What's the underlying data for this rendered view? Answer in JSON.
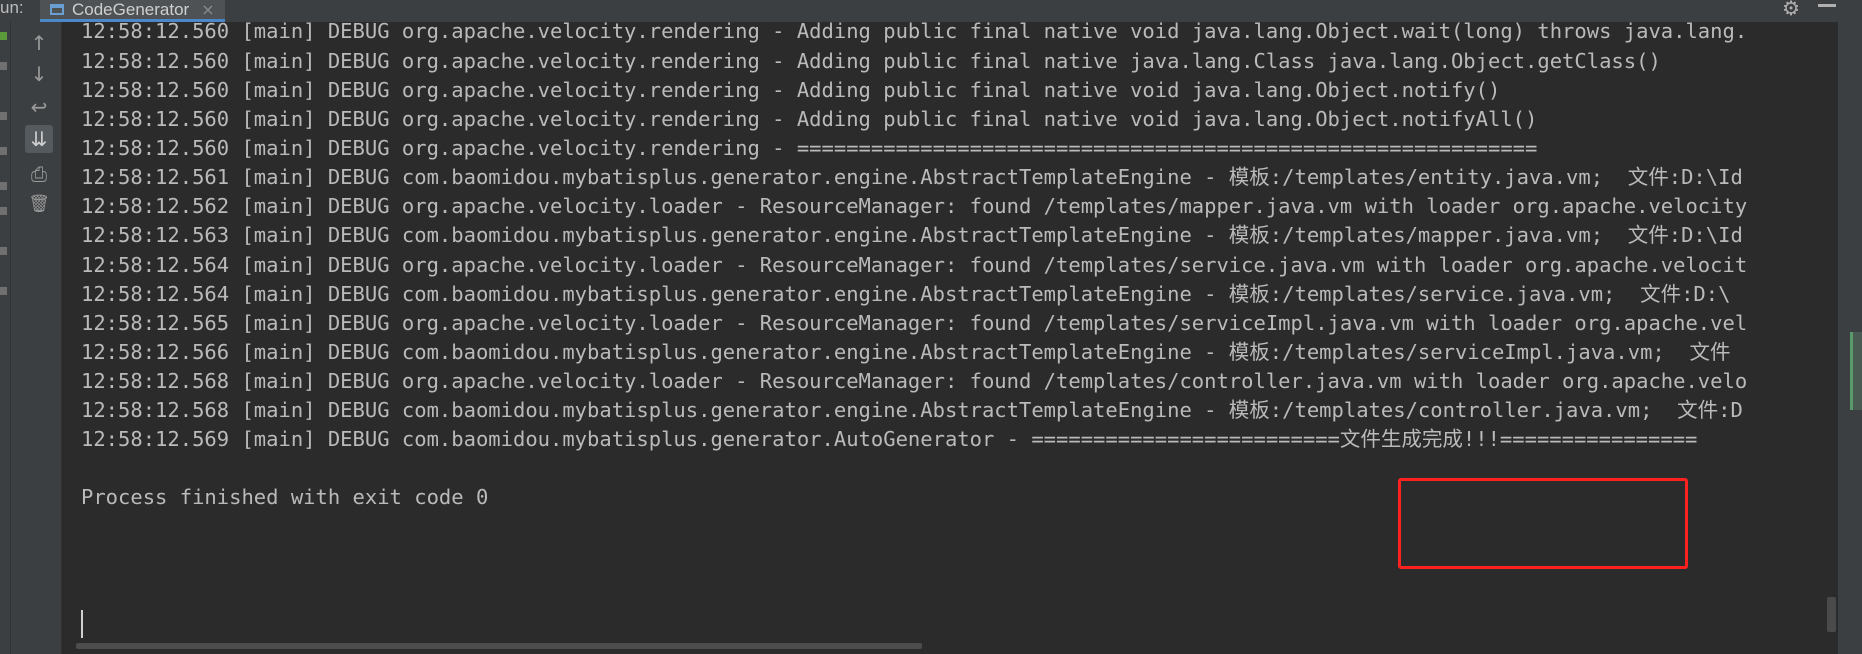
{
  "header": {
    "run_label": "un:",
    "tab_title": "CodeGenerator",
    "close_glyph": "×",
    "gear_glyph": "⚙"
  },
  "toolbar": {
    "up_glyph": "↑",
    "down_glyph": "↓",
    "wrap_glyph": "↩",
    "scroll_end_glyph": "⇊",
    "print_glyph": "⎙",
    "trash_glyph": "🗑"
  },
  "console": {
    "lines": [
      "12:58:12.560 [main] DEBUG org.apache.velocity.rendering - Adding public final native void java.lang.Object.wait(long) throws java.lang.",
      "12:58:12.560 [main] DEBUG org.apache.velocity.rendering - Adding public final native java.lang.Class java.lang.Object.getClass()",
      "12:58:12.560 [main] DEBUG org.apache.velocity.rendering - Adding public final native void java.lang.Object.notify()",
      "12:58:12.560 [main] DEBUG org.apache.velocity.rendering - Adding public final native void java.lang.Object.notifyAll()",
      "12:58:12.560 [main] DEBUG org.apache.velocity.rendering - ============================================================",
      "12:58:12.561 [main] DEBUG com.baomidou.mybatisplus.generator.engine.AbstractTemplateEngine - 模板:/templates/entity.java.vm;  文件:D:\\Id",
      "12:58:12.562 [main] DEBUG org.apache.velocity.loader - ResourceManager: found /templates/mapper.java.vm with loader org.apache.velocity",
      "12:58:12.563 [main] DEBUG com.baomidou.mybatisplus.generator.engine.AbstractTemplateEngine - 模板:/templates/mapper.java.vm;  文件:D:\\Id",
      "12:58:12.564 [main] DEBUG org.apache.velocity.loader - ResourceManager: found /templates/service.java.vm with loader org.apache.velocit",
      "12:58:12.564 [main] DEBUG com.baomidou.mybatisplus.generator.engine.AbstractTemplateEngine - 模板:/templates/service.java.vm;  文件:D:\\",
      "12:58:12.565 [main] DEBUG org.apache.velocity.loader - ResourceManager: found /templates/serviceImpl.java.vm with loader org.apache.vel",
      "12:58:12.566 [main] DEBUG com.baomidou.mybatisplus.generator.engine.AbstractTemplateEngine - 模板:/templates/serviceImpl.java.vm;  文件",
      "12:58:12.568 [main] DEBUG org.apache.velocity.loader - ResourceManager: found /templates/controller.java.vm with loader org.apache.velo",
      "12:58:12.568 [main] DEBUG com.baomidou.mybatisplus.generator.engine.AbstractTemplateEngine - 模板:/templates/controller.java.vm;  文件:D",
      "12:58:12.569 [main] DEBUG com.baomidou.mybatisplus.generator.AutoGenerator - =========================文件生成完成!!!================",
      "",
      "Process finished with exit code 0"
    ]
  }
}
